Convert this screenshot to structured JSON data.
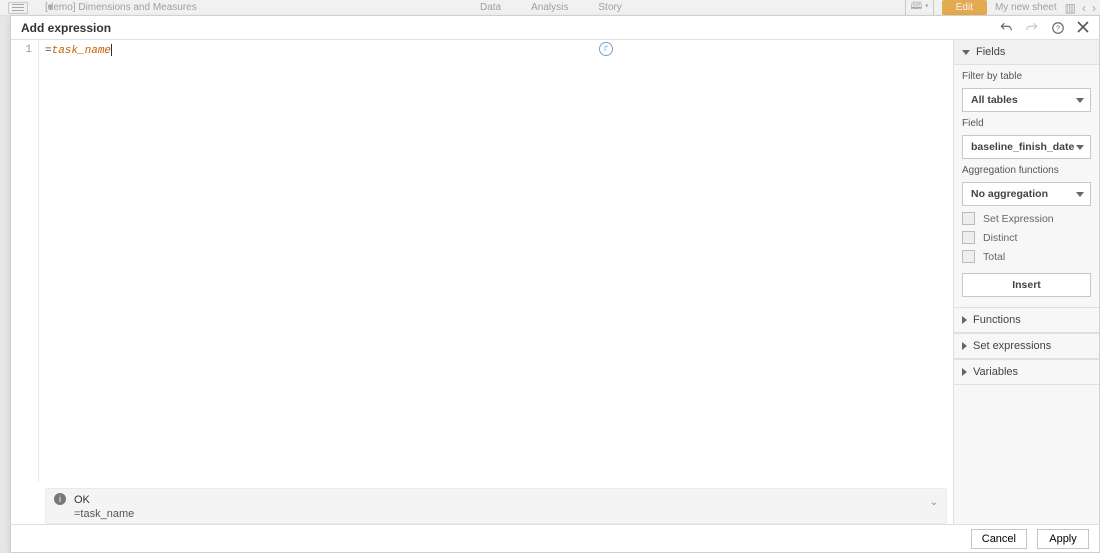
{
  "bg": {
    "title": "[demo] Dimensions and Measures",
    "tabs": [
      "Data",
      "Analysis",
      "Story"
    ],
    "edit": "Edit",
    "sheet": "My new sheet"
  },
  "modal": {
    "title": "Add expression",
    "undo": "undo",
    "redo": "redo",
    "editor": {
      "line_no": "1",
      "equals": "=",
      "code": "task_name"
    },
    "status": {
      "state": "OK",
      "expr": "=task_name"
    },
    "footer": {
      "cancel": "Cancel",
      "apply": "Apply"
    }
  },
  "side": {
    "fields": {
      "header": "Fields",
      "filter_label": "Filter by table",
      "filter_value": "All tables",
      "field_label": "Field",
      "field_value": "baseline_finish_date",
      "agg_label": "Aggregation functions",
      "agg_value": "No aggregation",
      "chk_setexpr": "Set Expression",
      "chk_distinct": "Distinct",
      "chk_total": "Total",
      "insert": "Insert"
    },
    "functions": "Functions",
    "setexpr": "Set expressions",
    "variables": "Variables"
  },
  "icons": {
    "undo": "undo-icon",
    "redo": "redo-icon",
    "help": "help-icon",
    "close": "close-icon",
    "fx": "function-badge",
    "info": "info-icon",
    "chev": "chevron-down-icon"
  }
}
